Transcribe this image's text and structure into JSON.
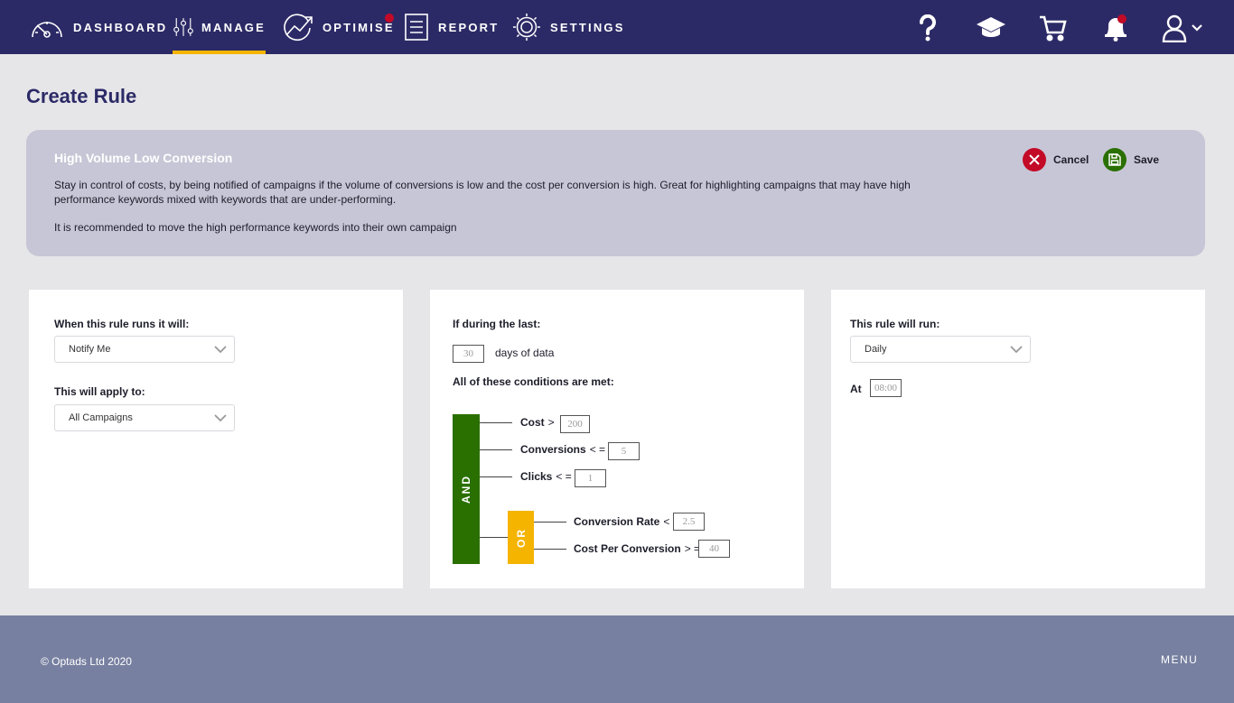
{
  "nav": {
    "items": [
      {
        "label": "DASHBOARD",
        "icon": "gauge-icon"
      },
      {
        "label": "MANAGE",
        "icon": "sliders-icon",
        "active": true
      },
      {
        "label": "OPTIMISE",
        "icon": "chart-trend-icon",
        "notification": true
      },
      {
        "label": "REPORT",
        "icon": "document-icon"
      },
      {
        "label": "SETTINGS",
        "icon": "gear-icon"
      }
    ],
    "right_icons": [
      "help-icon",
      "graduation-cap-icon",
      "cart-icon",
      "bell-icon",
      "user-icon",
      "chevron-down-icon"
    ],
    "accent": "#f5b400",
    "bg": "#2c2a66",
    "dot": "#c30a27"
  },
  "page": {
    "title": "Create Rule"
  },
  "info": {
    "title": "High Volume Low Conversion",
    "description": "Stay in control of costs, by being notified of campaigns if the volume of conversions is low and the cost per conversion is high. Great for highlighting campaigns that may have high performance keywords mixed with keywords that are under-performing.",
    "recommendation": "It is recommended to move the high performance keywords into their own campaign",
    "cancel_label": "Cancel",
    "save_label": "Save"
  },
  "action_card": {
    "runs_label": "When this rule runs it will:",
    "runs_value": "Notify Me",
    "apply_label": "This will apply to:",
    "apply_value": "All Campaigns"
  },
  "conditions_card": {
    "during_label": "If during the last:",
    "days_value": "30",
    "days_suffix": "days of data",
    "conditions_label": "All of these conditions are met:",
    "and_label": "AND",
    "or_label": "OR",
    "and_conditions": [
      {
        "name": "Cost",
        "op": ">",
        "value": "200"
      },
      {
        "name": "Conversions",
        "op": "< =",
        "value": "5"
      },
      {
        "name": "Clicks",
        "op": "< =",
        "value": "1"
      }
    ],
    "or_conditions": [
      {
        "name": "Conversion Rate",
        "op": "<",
        "value": "2.5"
      },
      {
        "name": "Cost Per Conversion",
        "op": "> =",
        "value": "40"
      }
    ]
  },
  "schedule_card": {
    "run_label": "This rule will run:",
    "run_value": "Daily",
    "at_label": "At",
    "at_value": "08:00"
  },
  "footer": {
    "copyright": "© Optads Ltd 2020",
    "menu_label": "MENU"
  }
}
